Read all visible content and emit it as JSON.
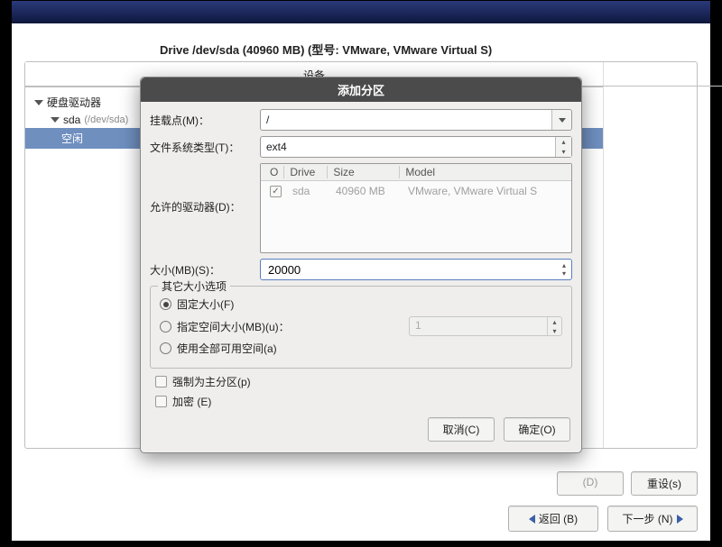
{
  "drive_header": "Drive /dev/sda (40960 MB) (型号: VMware, VMware Virtual S)",
  "tree": {
    "header": "设备",
    "root": "硬盘驱动器",
    "drive_name": "sda",
    "drive_path": "(/dev/sda)",
    "free": "空闲"
  },
  "main_buttons": {
    "d": "(D)",
    "reset": "重设(s)"
  },
  "nav_buttons": {
    "back": "返回 (B)",
    "next": "下一步 (N)"
  },
  "dialog": {
    "title": "添加分区",
    "mount_label": "挂载点(M)：",
    "mount_value": "/",
    "fs_label": "文件系统类型(T)：",
    "fs_value": "ext4",
    "allow_label": "允许的驱动器(D)：",
    "drive_table": {
      "headers": {
        "ck": "O",
        "drive": "Drive",
        "size": "Size",
        "model": "Model"
      },
      "row": {
        "drive": "sda",
        "size": "40960 MB",
        "model": "VMware, VMware Virtual S"
      }
    },
    "size_label": "大小(MB)(S)：",
    "size_value": "20000",
    "other_legend": "其它大小选项",
    "opt_fixed": "固定大小(F)",
    "opt_upto": "指定空间大小(MB)(u)：",
    "opt_upto_value": "1",
    "opt_all": "使用全部可用空间(a)",
    "force_primary": "强制为主分区(p)",
    "encrypt": "加密 (E)",
    "cancel": "取消(C)",
    "ok": "确定(O)"
  }
}
